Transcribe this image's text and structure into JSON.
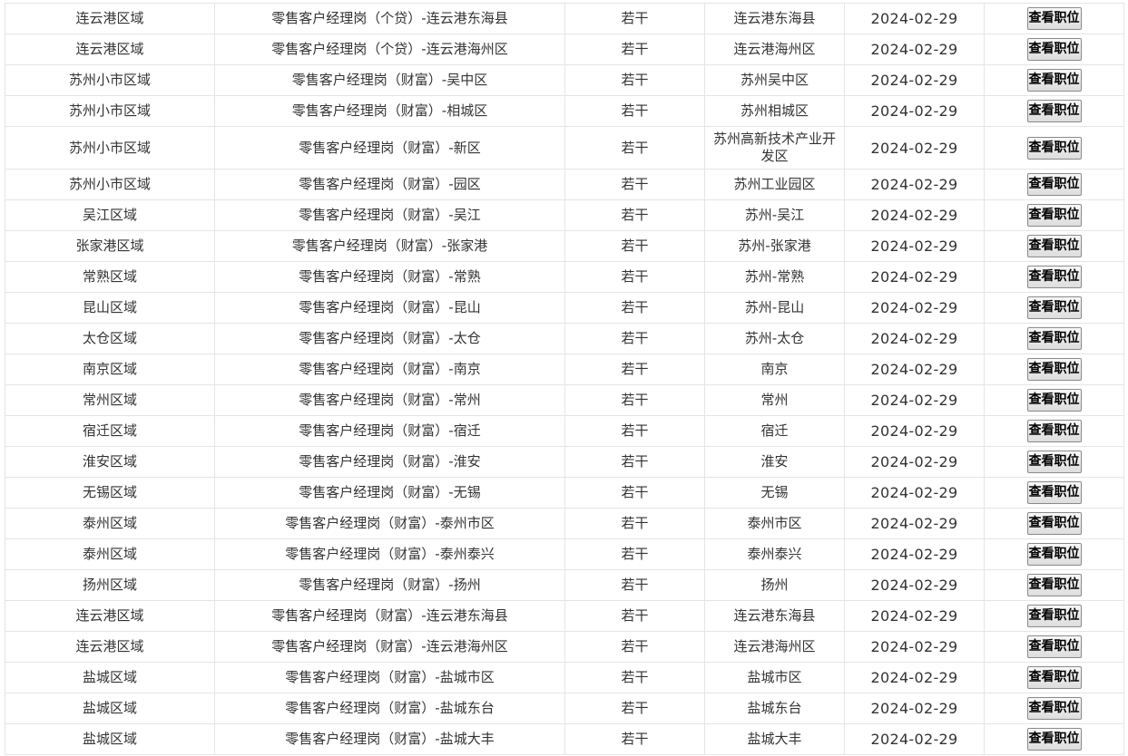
{
  "button_label": "查看职位",
  "rows": [
    {
      "region": "连云港区域",
      "position": "零售客户经理岗（个贷）-连云港东海县",
      "count": "若干",
      "location": "连云港东海县",
      "date": "2024-02-29"
    },
    {
      "region": "连云港区域",
      "position": "零售客户经理岗（个贷）-连云港海州区",
      "count": "若干",
      "location": "连云港海州区",
      "date": "2024-02-29"
    },
    {
      "region": "苏州小市区域",
      "position": "零售客户经理岗（财富）-吴中区",
      "count": "若干",
      "location": "苏州吴中区",
      "date": "2024-02-29"
    },
    {
      "region": "苏州小市区域",
      "position": "零售客户经理岗（财富）-相城区",
      "count": "若干",
      "location": "苏州相城区",
      "date": "2024-02-29"
    },
    {
      "region": "苏州小市区域",
      "position": "零售客户经理岗（财富）-新区",
      "count": "若干",
      "location": "苏州高新技术产业开发区",
      "date": "2024-02-29"
    },
    {
      "region": "苏州小市区域",
      "position": "零售客户经理岗（财富）-园区",
      "count": "若干",
      "location": "苏州工业园区",
      "date": "2024-02-29"
    },
    {
      "region": "吴江区域",
      "position": "零售客户经理岗（财富）-吴江",
      "count": "若干",
      "location": "苏州-吴江",
      "date": "2024-02-29"
    },
    {
      "region": "张家港区域",
      "position": "零售客户经理岗（财富）-张家港",
      "count": "若干",
      "location": "苏州-张家港",
      "date": "2024-02-29"
    },
    {
      "region": "常熟区域",
      "position": "零售客户经理岗（财富）-常熟",
      "count": "若干",
      "location": "苏州-常熟",
      "date": "2024-02-29"
    },
    {
      "region": "昆山区域",
      "position": "零售客户经理岗（财富）-昆山",
      "count": "若干",
      "location": "苏州-昆山",
      "date": "2024-02-29"
    },
    {
      "region": "太仓区域",
      "position": "零售客户经理岗（财富）-太仓",
      "count": "若干",
      "location": "苏州-太仓",
      "date": "2024-02-29"
    },
    {
      "region": "南京区域",
      "position": "零售客户经理岗（财富）-南京",
      "count": "若干",
      "location": "南京",
      "date": "2024-02-29"
    },
    {
      "region": "常州区域",
      "position": "零售客户经理岗（财富）-常州",
      "count": "若干",
      "location": "常州",
      "date": "2024-02-29"
    },
    {
      "region": "宿迁区域",
      "position": "零售客户经理岗（财富）-宿迁",
      "count": "若干",
      "location": "宿迁",
      "date": "2024-02-29"
    },
    {
      "region": "淮安区域",
      "position": "零售客户经理岗（财富）-淮安",
      "count": "若干",
      "location": "淮安",
      "date": "2024-02-29"
    },
    {
      "region": "无锡区域",
      "position": "零售客户经理岗（财富）-无锡",
      "count": "若干",
      "location": "无锡",
      "date": "2024-02-29"
    },
    {
      "region": "泰州区域",
      "position": "零售客户经理岗（财富）-泰州市区",
      "count": "若干",
      "location": "泰州市区",
      "date": "2024-02-29"
    },
    {
      "region": "泰州区域",
      "position": "零售客户经理岗（财富）-泰州泰兴",
      "count": "若干",
      "location": "泰州泰兴",
      "date": "2024-02-29"
    },
    {
      "region": "扬州区域",
      "position": "零售客户经理岗（财富）-扬州",
      "count": "若干",
      "location": "扬州",
      "date": "2024-02-29"
    },
    {
      "region": "连云港区域",
      "position": "零售客户经理岗（财富）-连云港东海县",
      "count": "若干",
      "location": "连云港东海县",
      "date": "2024-02-29"
    },
    {
      "region": "连云港区域",
      "position": "零售客户经理岗（财富）-连云港海州区",
      "count": "若干",
      "location": "连云港海州区",
      "date": "2024-02-29"
    },
    {
      "region": "盐城区域",
      "position": "零售客户经理岗（财富）-盐城市区",
      "count": "若干",
      "location": "盐城市区",
      "date": "2024-02-29"
    },
    {
      "region": "盐城区域",
      "position": "零售客户经理岗（财富）-盐城东台",
      "count": "若干",
      "location": "盐城东台",
      "date": "2024-02-29"
    },
    {
      "region": "盐城区域",
      "position": "零售客户经理岗（财富）-盐城大丰",
      "count": "若干",
      "location": "盐城大丰",
      "date": "2024-02-29"
    }
  ]
}
